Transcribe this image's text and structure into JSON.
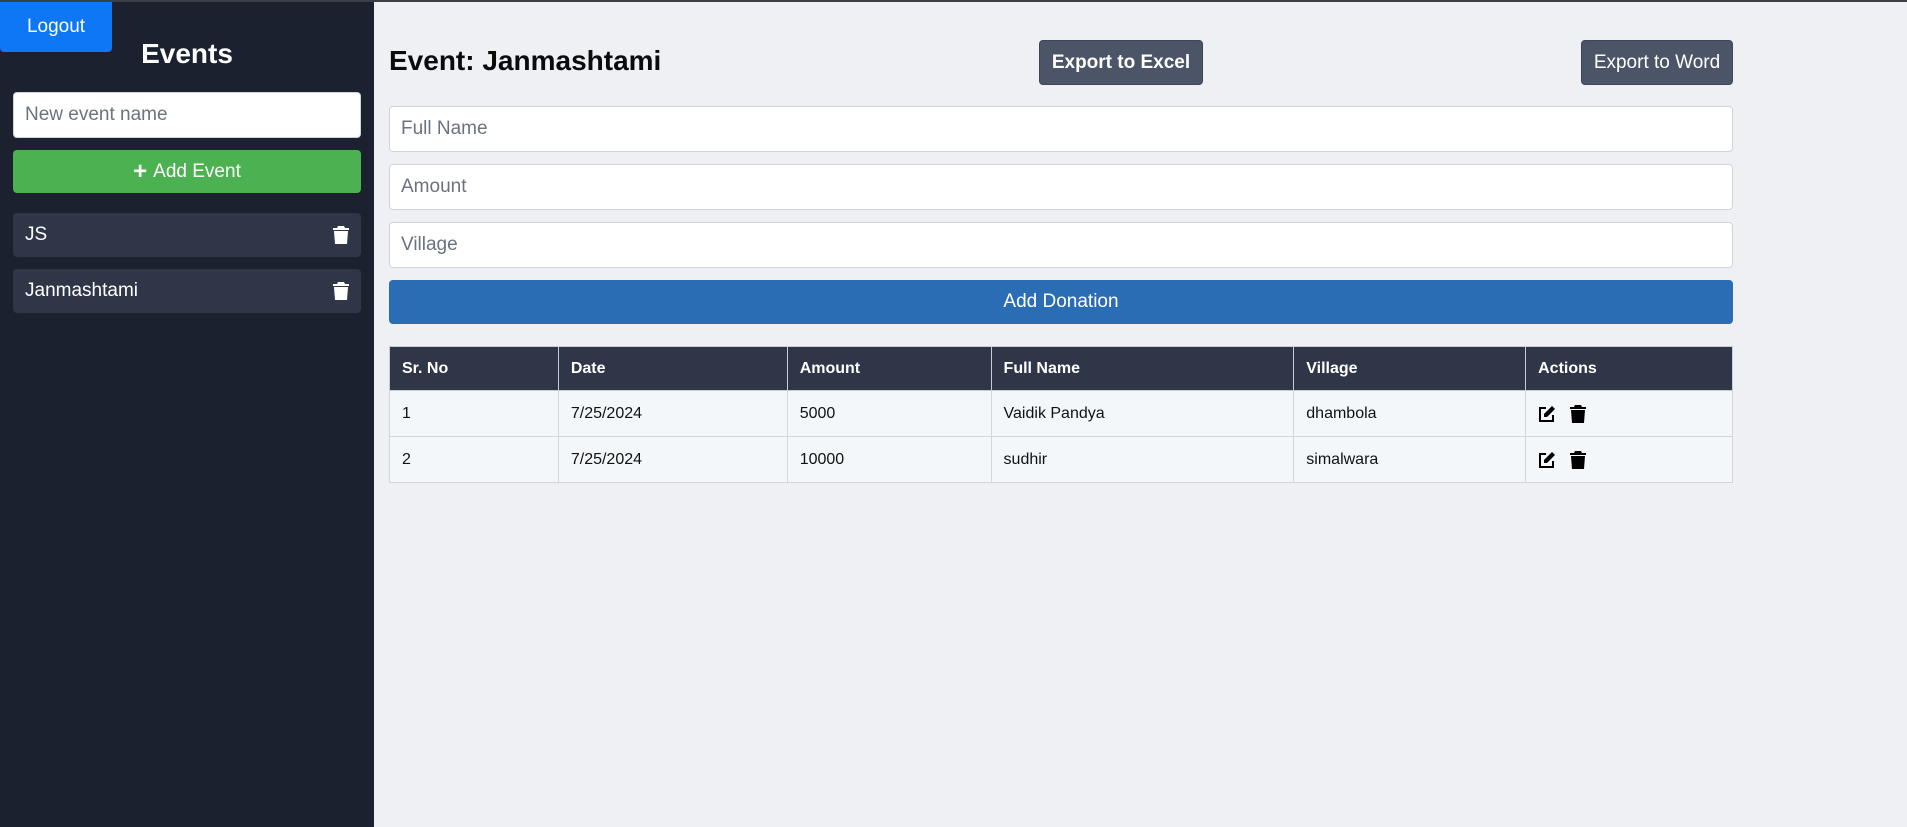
{
  "sidebar": {
    "logout_label": "Logout",
    "title": "Events",
    "new_event_placeholder": "New event name",
    "add_event_label": "Add Event",
    "events": [
      {
        "name": "JS"
      },
      {
        "name": "Janmashtami"
      }
    ]
  },
  "main": {
    "title": "Event: Janmashtami",
    "export_excel_label": "Export to Excel",
    "export_word_label": "Export to Word",
    "form": {
      "full_name_placeholder": "Full Name",
      "amount_placeholder": "Amount",
      "village_placeholder": "Village",
      "submit_label": "Add Donation"
    },
    "table": {
      "headers": [
        "Sr. No",
        "Date",
        "Amount",
        "Full Name",
        "Village",
        "Actions"
      ],
      "rows": [
        [
          "1",
          "7/25/2024",
          "5000",
          "Vaidik Pandya",
          "dhambola"
        ],
        [
          "2",
          "7/25/2024",
          "10000",
          "sudhir",
          "simalwara"
        ]
      ]
    }
  },
  "colors": {
    "sidebar_bg": "#1c2130",
    "logout": "#0d77f6",
    "add_event": "#4cb151",
    "add_donation": "#2a6db5",
    "export": "#4b5567",
    "table_header": "#2e3648"
  },
  "icons": [
    "trash-icon",
    "edit-icon",
    "plus-icon"
  ]
}
